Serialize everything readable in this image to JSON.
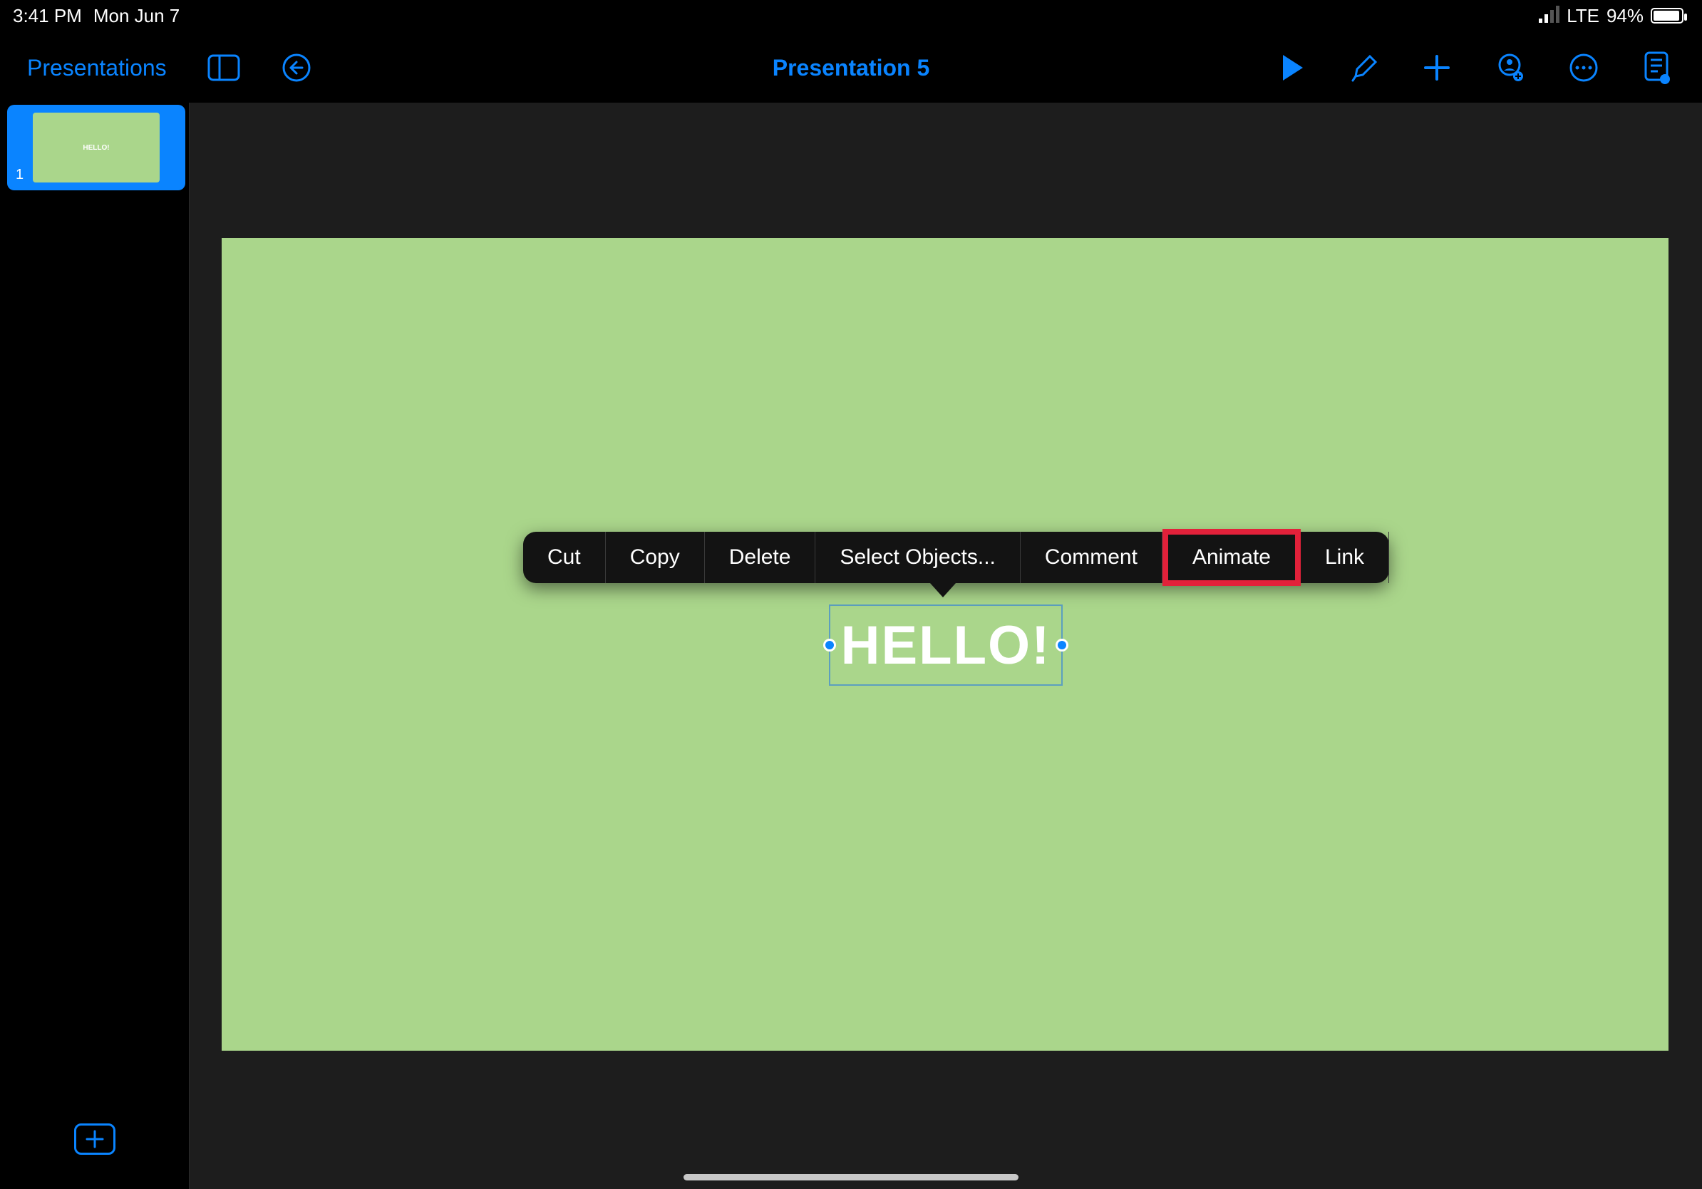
{
  "status_bar": {
    "time": "3:41 PM",
    "date": "Mon Jun 7",
    "network": "LTE",
    "battery_pct": "94%"
  },
  "toolbar": {
    "back_label": "Presentations",
    "title": "Presentation 5"
  },
  "sidebar": {
    "slide_number": "1",
    "thumb_text": "HELLO!"
  },
  "slide": {
    "text_content": "HELLO!",
    "background": "#aad68b"
  },
  "context_menu": {
    "items": [
      "Cut",
      "Copy",
      "Delete",
      "Select Objects...",
      "Comment",
      "Animate",
      "Link"
    ],
    "highlighted": "Animate"
  },
  "colors": {
    "accent": "#0a84ff",
    "highlight_border": "#e2213a"
  }
}
